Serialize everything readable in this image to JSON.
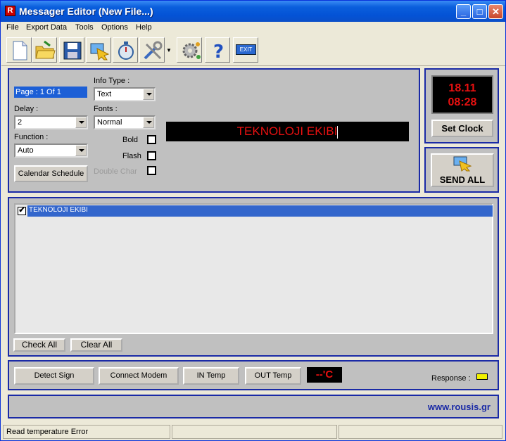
{
  "window": {
    "title": "Messager Editor  (New File...)"
  },
  "menu": [
    "File",
    "Export Data",
    "Tools",
    "Options",
    "Help"
  ],
  "toolbar": {
    "tools": [
      "new-file",
      "open-folder",
      "save-disk",
      "download-display",
      "stopwatch",
      "tools-wrench",
      "settings-gear",
      "help-question",
      "exit"
    ],
    "exit_label": "EXIT"
  },
  "editor": {
    "page": "Page : 1 Of 1",
    "info_type_label": "Info Type :",
    "info_type_value": "Text",
    "delay_label": "Delay :",
    "delay_value": "2",
    "fonts_label": "Fonts :",
    "fonts_value": "Normal",
    "function_label": "Function :",
    "function_value": "Auto",
    "bold_label": "Bold",
    "flash_label": "Flash",
    "double_char_label": "Double Char",
    "calendar_button": "Calendar Schedule",
    "preview_text": "TEKNOLOJI EKIBI"
  },
  "clock": {
    "date": "18.11",
    "time": "08:28",
    "set_button": "Set Clock"
  },
  "send": {
    "label": "SEND ALL"
  },
  "messages": {
    "items": [
      {
        "checked": true,
        "text": "TEKNOLOJI EKIBI"
      }
    ],
    "check_all": "Check All",
    "clear_all": "Clear All"
  },
  "controls": {
    "detect_sign": "Detect Sign",
    "connect_modem": "Connect Modem",
    "in_temp": "IN Temp",
    "out_temp": "OUT Temp",
    "temp_display": "--'C",
    "response_label": "Response :"
  },
  "footer": {
    "website": "www.rousis.gr"
  },
  "statusbar": {
    "message": "Read temperature Error",
    "cell2": "",
    "cell3": ""
  },
  "colors": {
    "panel_border": "#1a2aa6",
    "led_text": "#e81010",
    "selection": "#3366cc",
    "response_indicator": "#f0f000"
  }
}
